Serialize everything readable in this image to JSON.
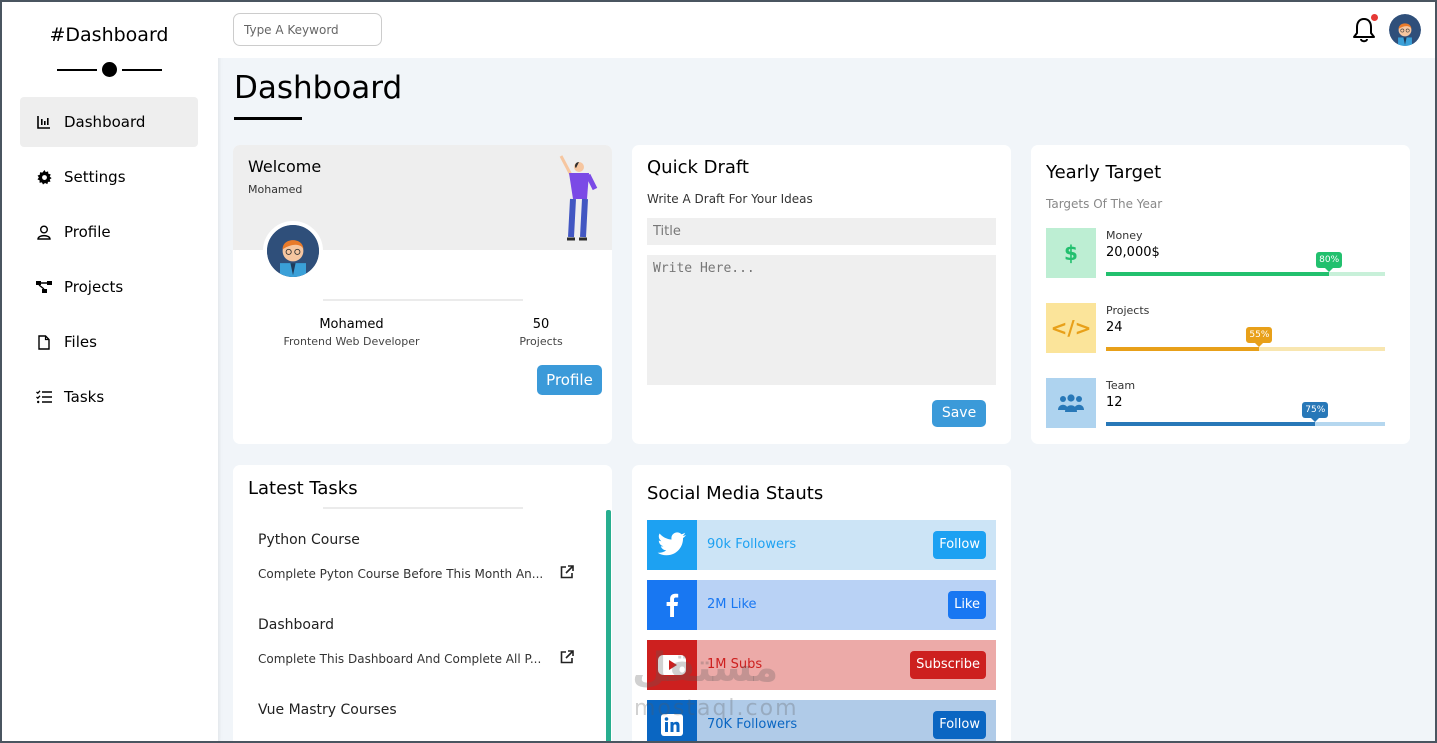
{
  "sidebar": {
    "brand": "#Dashboard",
    "items": [
      {
        "label": "Dashboard",
        "icon": "chart-icon",
        "active": true
      },
      {
        "label": "Settings",
        "icon": "gear-icon"
      },
      {
        "label": "Profile",
        "icon": "user-icon"
      },
      {
        "label": "Projects",
        "icon": "diagram-icon"
      },
      {
        "label": "Files",
        "icon": "file-icon"
      },
      {
        "label": "Tasks",
        "icon": "list-check-icon"
      }
    ]
  },
  "header": {
    "search_placeholder": "Type A Keyword",
    "notification_icon": "bell-icon",
    "avatar": "avatar"
  },
  "page": {
    "title": "Dashboard"
  },
  "welcome": {
    "title": "Welcome",
    "name": "Mohamed",
    "profile_name": "Mohamed",
    "profile_role": "Frontend Web Developer",
    "projects_count": "50",
    "projects_label": "Projects",
    "button": "Profile"
  },
  "draft": {
    "title": "Quick Draft",
    "subtitle": "Write A Draft For Your Ideas",
    "title_placeholder": "Title",
    "body_placeholder": "Write Here...",
    "button": "Save"
  },
  "target": {
    "title": "Yearly Target",
    "subtitle": "Targets Of The Year",
    "rows": [
      {
        "label": "Money",
        "value": "20,000$",
        "percent": 80,
        "percent_label": "80%",
        "icon": "dollar-icon",
        "icon_text": "$",
        "color": "#22c06e",
        "light": "#bdeed3",
        "track": "#c8f0d9"
      },
      {
        "label": "Projects",
        "value": "24",
        "percent": 55,
        "percent_label": "55%",
        "icon": "code-icon",
        "icon_text": "</>",
        "color": "#e8a019",
        "light": "#fbe49a",
        "track": "#f8e6b0"
      },
      {
        "label": "Team",
        "value": "12",
        "percent": 75,
        "percent_label": "75%",
        "icon": "users-icon",
        "icon_text": "",
        "color": "#2878b8",
        "light": "#aed3ef",
        "track": "#b5d7ef"
      }
    ]
  },
  "tasks": {
    "title": "Latest Tasks",
    "items": [
      {
        "title": "Python Course",
        "desc": "Complete Pyton Course Before This Month An..."
      },
      {
        "title": "Dashboard",
        "desc": "Complete This Dashboard And Complete All P..."
      },
      {
        "title": "Vue Mastry Courses",
        "desc": ""
      }
    ]
  },
  "social": {
    "title": "Social Media Stauts",
    "rows": [
      {
        "network": "twitter",
        "icon": "twitter-icon",
        "text": "90k Followers",
        "button": "Follow",
        "bg": "#cce4f6",
        "iconbg": "#1da1f2",
        "btn": "#1da1f2",
        "textcolor": "#1da1f2"
      },
      {
        "network": "facebook",
        "icon": "facebook-icon",
        "text": "2M Like",
        "button": "Like",
        "bg": "#b9d2f5",
        "iconbg": "#1877f2",
        "btn": "#1877f2",
        "textcolor": "#1877f2"
      },
      {
        "network": "youtube",
        "icon": "youtube-icon",
        "text": "1M Subs",
        "button": "Subscribe",
        "bg": "#ecaaa8",
        "iconbg": "#cd201f",
        "btn": "#cd201f",
        "textcolor": "#cd201f"
      },
      {
        "network": "linkedin",
        "icon": "linkedin-icon",
        "text": "70K Followers",
        "button": "Follow",
        "bg": "#b0cbe8",
        "iconbg": "#0a66c2",
        "btn": "#0a66c2",
        "textcolor": "#0a66c2"
      }
    ]
  },
  "watermark": {
    "text": "مستقل",
    "sub": "mostaql.com"
  }
}
